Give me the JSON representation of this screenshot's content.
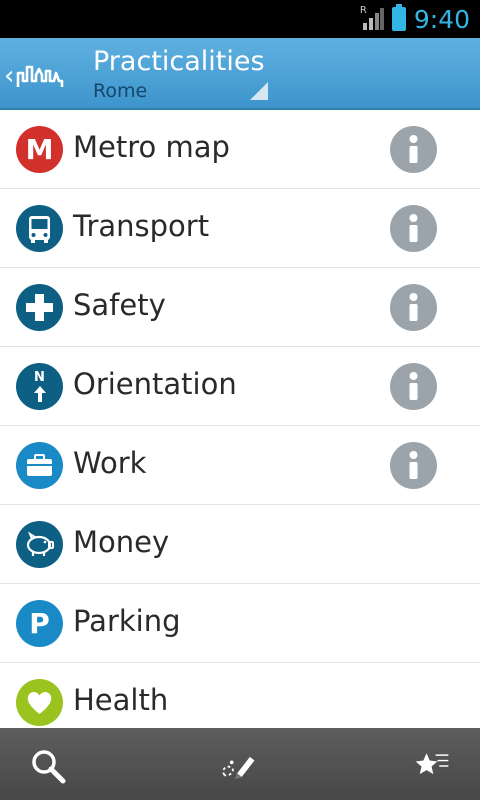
{
  "status_bar": {
    "time": "9:40",
    "network_label": "R",
    "signal_icon": "signal-icon",
    "battery_icon": "battery-icon",
    "accent": "#33b5e5"
  },
  "header": {
    "back_icon": "back-chevron-icon",
    "logo_icon": "city-skyline-logo-icon",
    "title": "Practicalities",
    "subtitle": "Rome",
    "dropdown_icon": "dropdown-triangle-icon",
    "background": "#4aa3d8"
  },
  "list": {
    "items": [
      {
        "label": "Metro map",
        "icon": "metro-icon",
        "icon_text": "M",
        "icon_color": "#d2302b",
        "has_info": true
      },
      {
        "label": "Transport",
        "icon": "bus-icon",
        "icon_color": "#0e5f84",
        "has_info": true
      },
      {
        "label": "Safety",
        "icon": "cross-icon",
        "icon_color": "#0e5f84",
        "has_info": true
      },
      {
        "label": "Orientation",
        "icon": "compass-north-icon",
        "icon_text": "N",
        "icon_color": "#0e5f84",
        "has_info": true
      },
      {
        "label": "Work",
        "icon": "briefcase-icon",
        "icon_color": "#1a8ac6",
        "has_info": true
      },
      {
        "label": "Money",
        "icon": "piggy-bank-icon",
        "icon_color": "#0e5f84",
        "has_info": false
      },
      {
        "label": "Parking",
        "icon": "parking-icon",
        "icon_text": "P",
        "icon_color": "#1a8ac6",
        "has_info": false
      },
      {
        "label": "Health",
        "icon": "heart-icon",
        "icon_color": "#9bc31f",
        "has_info": false
      }
    ],
    "info_icon": "info-icon",
    "info_color": "#9aa4aa"
  },
  "bottom_bar": {
    "buttons": [
      {
        "icon": "search-icon"
      },
      {
        "icon": "route-pencil-icon"
      },
      {
        "icon": "favorite-stars-icon"
      }
    ],
    "background": "#525252"
  }
}
